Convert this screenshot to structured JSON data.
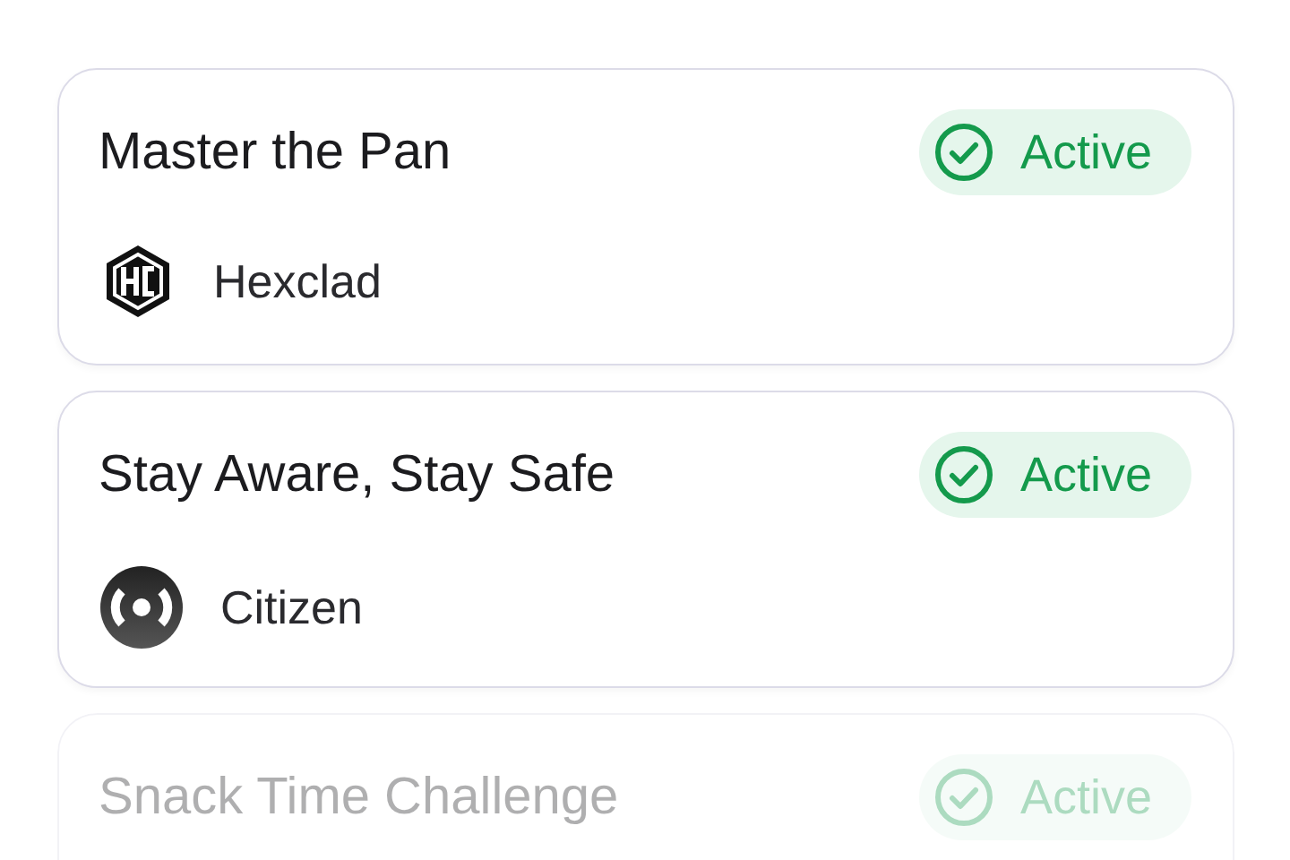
{
  "cards": [
    {
      "title": "Master the Pan",
      "status": {
        "label": "Active",
        "kind": "active"
      },
      "brand": {
        "name": "Hexclad",
        "kind": "hexagon"
      },
      "faded": false
    },
    {
      "title": "Stay Aware, Stay Safe",
      "status": {
        "label": "Active",
        "kind": "active"
      },
      "brand": {
        "name": "Citizen",
        "kind": "circle"
      },
      "faded": false
    },
    {
      "title": "Snack Time Challenge",
      "status": {
        "label": "Active",
        "kind": "active"
      },
      "faded": true
    }
  ]
}
